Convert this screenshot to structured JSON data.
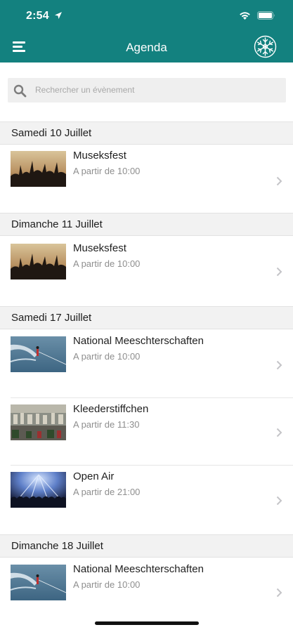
{
  "status": {
    "time": "2:54"
  },
  "nav": {
    "title": "Agenda"
  },
  "search": {
    "placeholder": "Rechercher un évènement"
  },
  "sections": [
    {
      "label": "Samedi 10 Juillet"
    },
    {
      "label": "Dimanche 11 Juillet"
    },
    {
      "label": "Samedi 17 Juillet"
    },
    {
      "label": "Dimanche 18 Juillet"
    }
  ],
  "events": [
    {
      "title": "Museksfest",
      "time": "A partir de 10:00",
      "image": "concert-crowd"
    },
    {
      "title": "Museksfest",
      "time": "A partir de 10:00",
      "image": "concert-crowd"
    },
    {
      "title": "National Meeschterschaften",
      "time": "A partir de 10:00",
      "image": "water-ski"
    },
    {
      "title": "Kleederstiffchen",
      "time": "A partir de 11:30",
      "image": "market-street"
    },
    {
      "title": "Open Air",
      "time": "A partir de 21:00",
      "image": "stage-lights"
    },
    {
      "title": "National Meeschterschaften",
      "time": "A partir de 10:00",
      "image": "water-ski"
    }
  ],
  "colors": {
    "header": "#13817f",
    "section_bg": "#f2f2f2",
    "subtitle": "#8e8e8e"
  },
  "icons": {
    "menu": "hamburger-menu-icon",
    "logo": "snowflake-logo-icon",
    "search": "search-icon",
    "chevron": "chevron-right-icon"
  }
}
